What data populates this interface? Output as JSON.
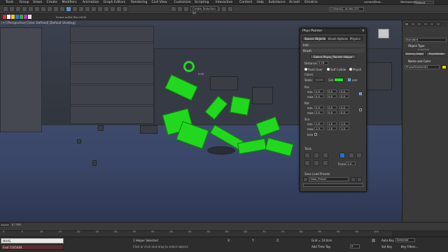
{
  "menu": {
    "items": [
      "Tools",
      "Group",
      "Views",
      "Create",
      "Modifiers",
      "Animation",
      "Graph Editors",
      "Rendering",
      "Civil View",
      "Customize",
      "Scripting",
      "Interactive",
      "Content",
      "Help",
      "Substance",
      "Arnold",
      "Ornatrix"
    ],
    "user": "contact@troc...",
    "workspaces_label": "Workspaces:",
    "workspace_value": "Default"
  },
  "toolbar": {
    "selection_set_placeholder": "Create Selection Se",
    "search_text": "",
    "path_text": "C:\\Users\\Q...ds Max 202",
    "ribbon_text": "Select   edSel   fSel   nSOX"
  },
  "viewport": {
    "label": "[+] [Perspective] [User Defined] [Default Shading]",
    "brush_readout": "0.05"
  },
  "phys_painter": {
    "title": "Phys Painter",
    "close": "×",
    "tabs": [
      "Source Objects",
      "Brush Options",
      "Physics"
    ],
    "active_tab": 0,
    "info_label": "Info",
    "brush_label": "Brush",
    "select_button": "Select Physx_Painter Helper",
    "distance_label": "Distance",
    "distance_value": "0.18",
    "paint_over_label": "Paint Over",
    "self_collide_label": "Self Collide",
    "physx_label": "PhysX",
    "colors_label": "Colors",
    "static_label": "Static",
    "sim_label": "Sim",
    "use_label": "use",
    "static_color": "#4a4a4a",
    "sim_color": "#18e61a",
    "pos_label": "Pos",
    "rot_label": "Rot",
    "scale_label": "Sca",
    "min_label": "min",
    "max_label": "max",
    "lock_label": "lock",
    "pos_rows": [
      [
        "0.0",
        "0.0",
        "0.0"
      ],
      [
        "0.0",
        "0.0",
        "0.0"
      ]
    ],
    "rot_rows": [
      [
        "0.0",
        "0.0",
        "0.0"
      ],
      [
        "0.0",
        "0.0",
        "0.0"
      ]
    ],
    "scale_rows": [
      [
        "1.0",
        "1.0",
        "1.0"
      ],
      [
        "1.0",
        "1.0",
        "1.0"
      ]
    ],
    "tools_label": "Tools",
    "force_label": "Force",
    "force_value": "1.0",
    "presets_label": "Save Load Presets",
    "preset_value": "New_Preset"
  },
  "command_panel": {
    "tab_icons": [
      "create-icon",
      "modify-icon",
      "hierarchy-icon",
      "motion-icon",
      "display-icon",
      "utilities-icon"
    ],
    "category": "Standard",
    "type_header": "Object Type",
    "autogrid_label": "AutoGrid",
    "btn_dummy": "Dummy_Helper",
    "btn_physx": "PhysxPainter",
    "name_header": "Name and Color",
    "name_value": "PhysxPainter001",
    "name_color": "#e8d400"
  },
  "timeline": {
    "frame_label": "0 / 100",
    "ticks": [
      "0",
      "5",
      "10",
      "15",
      "20",
      "25",
      "30",
      "35",
      "40",
      "45",
      "50",
      "55",
      "60",
      "65",
      "70",
      "75",
      "80",
      "85",
      "90",
      "95",
      "100"
    ]
  },
  "status": {
    "maxscript": "MAXS",
    "listener": "Eval 1165484",
    "selection": "1 Helper Selected",
    "hint": "Click or click-and-drag to select objects",
    "x_label": "X:",
    "y_label": "Y:",
    "z_label": "Z:",
    "grid": "Grid = 10.0cm",
    "add_time_tag": "Add Time Tag",
    "autokey": "Auto Key",
    "autokey_mode": "Selected",
    "set_key": "Set Key",
    "key_filters": "Key Filters...",
    "frame_value": "0"
  }
}
